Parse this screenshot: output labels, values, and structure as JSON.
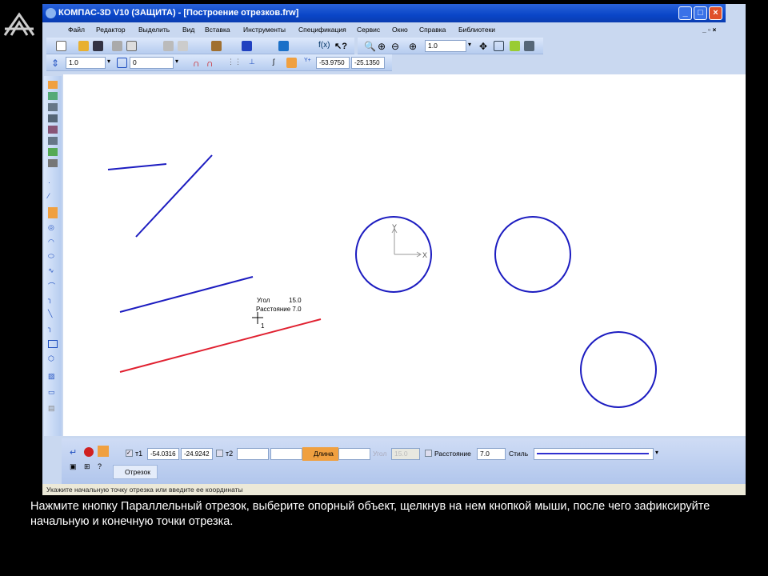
{
  "window": {
    "title": "КОМПАС-3D V10 (ЗАЩИТА) - [Построение отрезков.frw]",
    "min": "_",
    "max": "□",
    "close": "×"
  },
  "menu": [
    "Файл",
    "Редактор",
    "Выделить",
    "Вид",
    "Вставка",
    "Инструменты",
    "Спецификация",
    "Сервис",
    "Окно",
    "Справка",
    "Библиотеки"
  ],
  "toolbar": {
    "zoom_value": "1.0",
    "step_value": "1.0",
    "layer_value": "0",
    "x_coord": "-53.9750",
    "y_coord": "-25.1350"
  },
  "canvas": {
    "hint_angle_label": "Угол",
    "hint_angle_value": "15.0",
    "hint_distance": "Расстояние 7.0",
    "cursor_point": "1",
    "axis_x": "X",
    "axis_y": "Y",
    "line_color": "#1c1cc0",
    "active_color": "#e02030"
  },
  "props": {
    "t1_label": "т1",
    "t1_x": "-54.0316",
    "t1_y": "-24.9242",
    "t2_label": "т2",
    "t2_x": "",
    "t2_y": "",
    "length_label": "Длина",
    "length_value": "",
    "angle_label": "Угол",
    "angle_value": "15.0",
    "distance_label": "Расстояние",
    "distance_value": "7.0",
    "style_label": "Стиль",
    "tab_label": "Отрезок"
  },
  "status": "Укажите начальную точку отрезка или введите ее координаты",
  "subtitle": "Нажмите кнопку Параллельный отрезок, выберите опорный объект, щелкнув на нем кнопкой мыши, после чего зафиксируйте начальную и конечную точки отрезка."
}
